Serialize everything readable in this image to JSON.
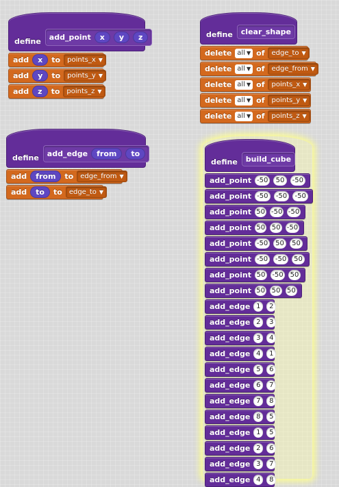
{
  "define_keyword": "define",
  "add_point_def": {
    "name": "add_point",
    "params": [
      "x",
      "y",
      "z"
    ],
    "body": [
      {
        "op": "add",
        "param": "x",
        "to": "to",
        "list": "points_x"
      },
      {
        "op": "add",
        "param": "y",
        "to": "to",
        "list": "points_y"
      },
      {
        "op": "add",
        "param": "z",
        "to": "to",
        "list": "points_z"
      }
    ]
  },
  "add_edge_def": {
    "name": "add_edge",
    "params": [
      "from",
      "to"
    ],
    "body": [
      {
        "op": "add",
        "param": "from",
        "to": "to",
        "list": "edge_from"
      },
      {
        "op": "add",
        "param": "to",
        "to": "to",
        "list": "edge_to"
      }
    ]
  },
  "clear_shape_def": {
    "name": "clear_shape",
    "body": [
      {
        "op": "delete",
        "item": "all",
        "of": "of",
        "list": "edge_to"
      },
      {
        "op": "delete",
        "item": "all",
        "of": "of",
        "list": "edge_from"
      },
      {
        "op": "delete",
        "item": "all",
        "of": "of",
        "list": "points_x"
      },
      {
        "op": "delete",
        "item": "all",
        "of": "of",
        "list": "points_y"
      },
      {
        "op": "delete",
        "item": "all",
        "of": "of",
        "list": "points_z"
      }
    ]
  },
  "build_cube_def": {
    "name": "build_cube",
    "calls": [
      {
        "name": "add_point",
        "args": [
          "-50",
          "50",
          "-50"
        ]
      },
      {
        "name": "add_point",
        "args": [
          "-50",
          "-50",
          "-50"
        ]
      },
      {
        "name": "add_point",
        "args": [
          "50",
          "-50",
          "-50"
        ]
      },
      {
        "name": "add_point",
        "args": [
          "50",
          "50",
          "-50"
        ]
      },
      {
        "name": "add_point",
        "args": [
          "-50",
          "50",
          "50"
        ]
      },
      {
        "name": "add_point",
        "args": [
          "-50",
          "-50",
          "50"
        ]
      },
      {
        "name": "add_point",
        "args": [
          "50",
          "-50",
          "50"
        ]
      },
      {
        "name": "add_point",
        "args": [
          "50",
          "50",
          "50"
        ]
      },
      {
        "name": "add_edge",
        "args": [
          "1",
          "2"
        ]
      },
      {
        "name": "add_edge",
        "args": [
          "2",
          "3"
        ]
      },
      {
        "name": "add_edge",
        "args": [
          "3",
          "4"
        ]
      },
      {
        "name": "add_edge",
        "args": [
          "4",
          "1"
        ]
      },
      {
        "name": "add_edge",
        "args": [
          "5",
          "6"
        ]
      },
      {
        "name": "add_edge",
        "args": [
          "6",
          "7"
        ]
      },
      {
        "name": "add_edge",
        "args": [
          "7",
          "8"
        ]
      },
      {
        "name": "add_edge",
        "args": [
          "8",
          "5"
        ]
      },
      {
        "name": "add_edge",
        "args": [
          "1",
          "5"
        ]
      },
      {
        "name": "add_edge",
        "args": [
          "2",
          "6"
        ]
      },
      {
        "name": "add_edge",
        "args": [
          "3",
          "7"
        ]
      },
      {
        "name": "add_edge",
        "args": [
          "4",
          "8"
        ]
      }
    ]
  },
  "icons": {
    "dropdown": "dropdown-arrow-icon"
  },
  "colors": {
    "custom": "#632d99",
    "list": "#d3691e",
    "param": "#5e47c2",
    "glow": "#ffff8c",
    "background": "#d9d9d9"
  }
}
